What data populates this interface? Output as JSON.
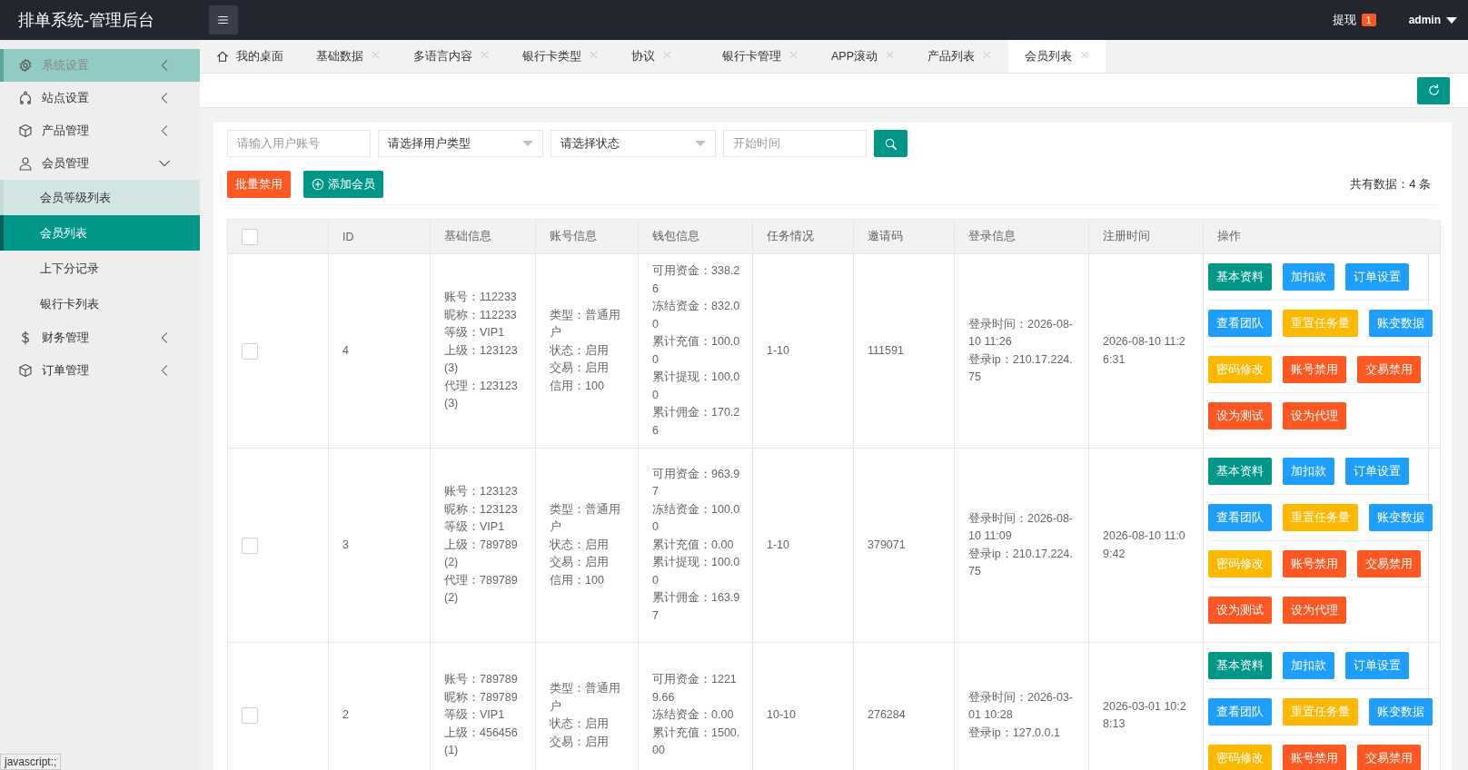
{
  "header": {
    "title": "排单系统-管理后台",
    "withdraw": {
      "label": "提现",
      "badge": "1"
    },
    "user": "admin"
  },
  "sidebar": {
    "items": [
      {
        "label": "系统设置",
        "selected": false,
        "highlighted": true,
        "expanded": false
      },
      {
        "label": "站点设置",
        "selected": false,
        "highlighted": false,
        "expanded": false
      },
      {
        "label": "产品管理",
        "selected": false,
        "highlighted": false,
        "expanded": false
      },
      {
        "label": "会员管理",
        "selected": false,
        "highlighted": false,
        "expanded": true,
        "children": [
          {
            "label": "会员等级列表",
            "selected": false,
            "highlighted": true
          },
          {
            "label": "会员列表",
            "selected": true,
            "highlighted": false
          },
          {
            "label": "上下分记录",
            "selected": false,
            "highlighted": false
          },
          {
            "label": "银行卡列表",
            "selected": false,
            "highlighted": false
          }
        ]
      },
      {
        "label": "财务管理",
        "selected": false,
        "highlighted": false,
        "expanded": false
      },
      {
        "label": "订单管理",
        "selected": false,
        "highlighted": false,
        "expanded": false
      }
    ]
  },
  "tabs": [
    {
      "label": "我的桌面",
      "kind": "home",
      "selected": false
    },
    {
      "label": "基础数据",
      "kind": "page",
      "selected": false
    },
    {
      "label": "多语言内容",
      "kind": "page",
      "selected": false
    },
    {
      "label": "银行卡类型",
      "kind": "page",
      "selected": false
    },
    {
      "label": "协议",
      "kind": "page",
      "selected": false
    },
    {
      "label": "银行卡管理",
      "kind": "page",
      "selected": false
    },
    {
      "label": "APP滚动",
      "kind": "page",
      "selected": false
    },
    {
      "label": "产品列表",
      "kind": "page",
      "selected": false
    },
    {
      "label": "会员列表",
      "kind": "page",
      "selected": true
    }
  ],
  "filters": [
    {
      "kind": "input",
      "placeholder": "请输入用户账号"
    },
    {
      "kind": "select",
      "value": "请选择用户类型"
    },
    {
      "kind": "select",
      "value": "请选择状态"
    },
    {
      "kind": "input",
      "placeholder": "开始时间"
    }
  ],
  "toolbar": {
    "buttons": [
      {
        "label": "批量禁用",
        "kind": "plain",
        "color": "#ff5722"
      },
      {
        "label": "添加会员",
        "kind": "add",
        "color": "#009688"
      }
    ],
    "total": "共有数据：4 条"
  },
  "table": {
    "header_checkbox": {
      "checked": false
    },
    "columns": [
      "ID",
      "基础信息",
      "账号信息",
      "钱包信息",
      "任务情况",
      "邀请码",
      "登录信息",
      "注册时间",
      "操作"
    ],
    "rows": [
      {
        "checked": false,
        "id": "4",
        "basic": [
          "账号：112233",
          "昵称：112233",
          "等级：VIP1",
          "上级：123123 (3)",
          "代理：123123 (3)"
        ],
        "account": [
          "类型：普通用户",
          "状态：启用",
          "交易：启用",
          "信用：100"
        ],
        "wallet": [
          "可用资金：338.26",
          "冻结资金：832.00",
          "累计充值：100.00",
          "累计提现：100.00",
          "累计佣金：170.26"
        ],
        "task": "1-10",
        "invite": "111591",
        "login": [
          "登录时间：2026-08-10 11:26",
          "登录ip：210.17.224.75"
        ],
        "registered": "2026-08-10 11:26:31",
        "actions": [
          [
            {
              "label": "基本资料",
              "color": "#009688"
            },
            {
              "label": "加扣款",
              "color": "#1e9fff"
            },
            {
              "label": "订单设置",
              "color": "#1e9fff"
            }
          ],
          [
            {
              "label": "查看团队",
              "color": "#1e9fff"
            },
            {
              "label": "重置任务量",
              "color": "#ffb800"
            },
            {
              "label": "账变数据",
              "color": "#1e9fff"
            }
          ],
          [
            {
              "label": "密码修改",
              "color": "#ffb800"
            },
            {
              "label": "账号禁用",
              "color": "#ff5722"
            },
            {
              "label": "交易禁用",
              "color": "#ff5722"
            }
          ],
          [
            {
              "label": "设为测试",
              "color": "#ff5722"
            },
            {
              "label": "设为代理",
              "color": "#ff5722"
            }
          ]
        ]
      },
      {
        "checked": false,
        "id": "3",
        "basic": [
          "账号：123123",
          "昵称：123123",
          "等级：VIP1",
          "上级：789789 (2)",
          "代理：789789 (2)"
        ],
        "account": [
          "类型：普通用户",
          "状态：启用",
          "交易：启用",
          "信用：100"
        ],
        "wallet": [
          "可用资金：963.97",
          "冻结资金：100.00",
          "累计充值：0.00",
          "累计提现：100.00",
          "累计佣金：163.97"
        ],
        "task": "1-10",
        "invite": "379071",
        "login": [
          "登录时间：2026-08-10 11:09",
          "登录ip：210.17.224.75"
        ],
        "registered": "2026-08-10 11:09:42",
        "actions": [
          [
            {
              "label": "基本资料",
              "color": "#009688"
            },
            {
              "label": "加扣款",
              "color": "#1e9fff"
            },
            {
              "label": "订单设置",
              "color": "#1e9fff"
            }
          ],
          [
            {
              "label": "查看团队",
              "color": "#1e9fff"
            },
            {
              "label": "重置任务量",
              "color": "#ffb800"
            },
            {
              "label": "账变数据",
              "color": "#1e9fff"
            }
          ],
          [
            {
              "label": "密码修改",
              "color": "#ffb800"
            },
            {
              "label": "账号禁用",
              "color": "#ff5722"
            },
            {
              "label": "交易禁用",
              "color": "#ff5722"
            }
          ],
          [
            {
              "label": "设为测试",
              "color": "#ff5722"
            },
            {
              "label": "设为代理",
              "color": "#ff5722"
            }
          ]
        ]
      },
      {
        "checked": false,
        "id": "2",
        "basic": [
          "账号：789789",
          "昵称：789789",
          "等级：VIP1",
          "上级：456456 (1)"
        ],
        "account": [
          "类型：普通用户",
          "状态：启用",
          "交易：启用"
        ],
        "wallet": [
          "可用资金：12219.66",
          "冻结资金：0.00",
          "累计充值：1500.00"
        ],
        "task": "10-10",
        "invite": "276284",
        "login": [
          "登录时间：2026-03-01 10:28",
          "登录ip：127.0.0.1"
        ],
        "registered": "2026-03-01 10:28:13",
        "actions": [
          [
            {
              "label": "基本资料",
              "color": "#009688"
            },
            {
              "label": "加扣款",
              "color": "#1e9fff"
            },
            {
              "label": "订单设置",
              "color": "#1e9fff"
            }
          ],
          [
            {
              "label": "查看团队",
              "color": "#1e9fff"
            },
            {
              "label": "重置任务量",
              "color": "#ffb800"
            },
            {
              "label": "账变数据",
              "color": "#1e9fff"
            }
          ],
          [
            {
              "label": "密码修改",
              "color": "#ffb800"
            },
            {
              "label": "账号禁用",
              "color": "#ff5722"
            },
            {
              "label": "交易禁用",
              "color": "#ff5722"
            }
          ]
        ]
      }
    ]
  },
  "status_bar": "javascript:;"
}
